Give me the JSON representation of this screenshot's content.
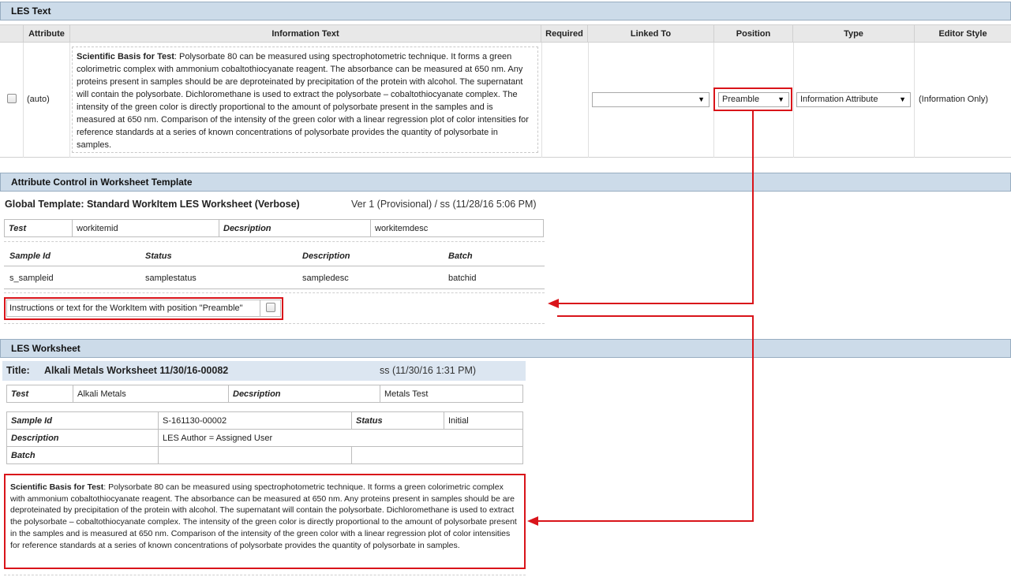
{
  "les_text": {
    "title": "LES Text",
    "columns": [
      "Attribute",
      "Information Text",
      "Required",
      "Linked To",
      "Position",
      "Type",
      "Editor Style"
    ],
    "row": {
      "attribute": "(auto)",
      "info_label": "Scientific Basis for Test",
      "info_body": ":  Polysorbate 80 can be measured using spectrophotometric technique. It forms a green colorimetric complex with ammonium cobaltothiocyanate reagent. The absorbance can be measured at 650 nm. Any proteins present in samples should be are deproteinated by precipitation of the protein with alcohol. The supernatant will contain the polysorbate. Dichloromethane is used to extract the polysorbate – cobaltothiocyanate complex. The intensity of the green color is directly proportional to the amount of polysorbate present in the samples and is measured at 650 nm. Comparison of the intensity of the green color with a linear regression plot of color intensities for reference standards at a series of known concentrations of polysorbate provides the quantity of polysorbate in samples.",
      "linked_to": "",
      "position": "Preamble",
      "type": "Information Attribute",
      "editor_style": "(Information Only)"
    }
  },
  "attribute_control": {
    "title": "Attribute Control in Worksheet Template",
    "template_title": "Global Template: Standard WorkItem LES Worksheet (Verbose)",
    "template_version": "Ver 1 (Provisional) / ss (11/28/16 5:06 PM)",
    "test_label": "Test",
    "test_value": "workitemid",
    "desc_label": "Decsription",
    "desc_value": "workitemdesc",
    "sample_headers": [
      "Sample Id",
      "Status",
      "Description",
      "Batch"
    ],
    "sample_values": [
      "s_sampleid",
      "samplestatus",
      "sampledesc",
      "batchid"
    ],
    "instruction": "Instructions or text for the WorkItem with position \"Preamble\""
  },
  "les_worksheet": {
    "title": "LES Worksheet",
    "ws_title_label": "Title:",
    "ws_title": "Alkali Metals Worksheet 11/30/16-00082",
    "ws_meta": "ss (11/30/16 1:31 PM)",
    "test_label": "Test",
    "test_value": "Alkali Metals",
    "desc_label": "Decsription",
    "desc_value": "Metals Test",
    "sample_id_label": "Sample Id",
    "sample_id_value": "S-161130-00002",
    "status_label": "Status",
    "status_value": "Initial",
    "description_label": "Description",
    "description_value": "LES Author = Assigned User",
    "batch_label": "Batch",
    "batch_value": "",
    "info_label": "Scientific Basis for Test",
    "info_body": ":  Polysorbate 80 can be measured using spectrophotometric technique. It forms a green colorimetric complex with ammonium cobaltothiocyanate reagent. The absorbance can be measured at 650 nm. Any proteins present in samples should be are deproteinated by precipitation of the protein with alcohol. The supernatant will contain the polysorbate. Dichloromethane is used to extract the polysorbate – cobaltothiocyanate complex. The intensity of the green color is directly proportional to the amount of polysorbate present in the samples and is measured at 650 nm. Comparison of the intensity of the green color with a linear regression plot of color intensities for reference standards at a series of known concentrations of polysorbate provides the quantity of polysorbate in samples."
  },
  "colors": {
    "section_bar": "#ccdbe9",
    "highlight": "#d9141a",
    "title_bar": "#dce6f1"
  }
}
